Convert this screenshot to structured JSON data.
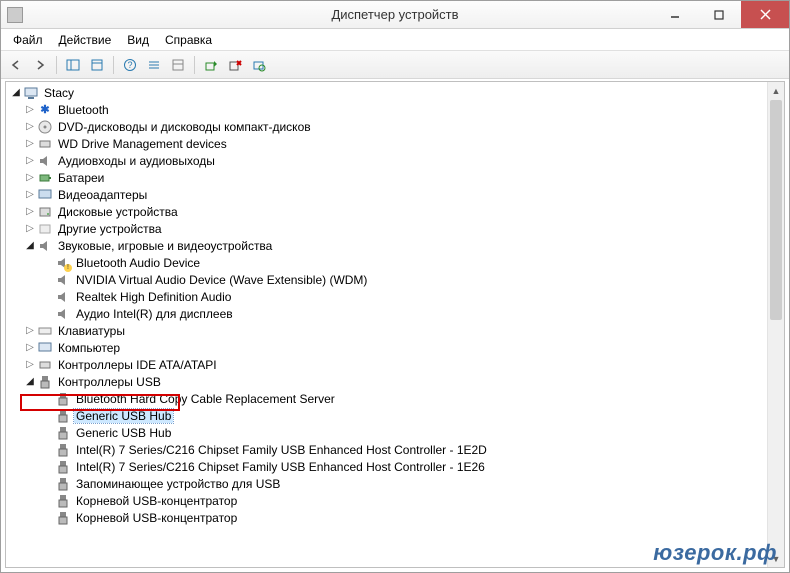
{
  "window": {
    "title": "Диспетчер устройств",
    "min_tooltip": "Свернуть",
    "max_tooltip": "Развернуть",
    "close_tooltip": "Закрыть"
  },
  "menu": {
    "file": "Файл",
    "action": "Действие",
    "view": "Вид",
    "help": "Справка"
  },
  "tree": {
    "root": "Stacy",
    "categories": [
      {
        "icon": "bluetooth",
        "label": "Bluetooth"
      },
      {
        "icon": "dvd",
        "label": "DVD-дисководы и дисководы компакт-дисков"
      },
      {
        "icon": "wd",
        "label": "WD Drive Management devices"
      },
      {
        "icon": "audio",
        "label": "Аудиовходы и аудиовыходы"
      },
      {
        "icon": "battery",
        "label": "Батареи"
      },
      {
        "icon": "video",
        "label": "Видеоадаптеры"
      },
      {
        "icon": "disk",
        "label": "Дисковые устройства"
      },
      {
        "icon": "other",
        "label": "Другие устройства"
      }
    ],
    "sound_category": {
      "label": "Звуковые, игровые и видеоустройства",
      "children": [
        {
          "label": "Bluetooth Audio Device",
          "warning": true
        },
        {
          "label": "NVIDIA Virtual Audio Device (Wave Extensible) (WDM)"
        },
        {
          "label": "Realtek High Definition Audio"
        },
        {
          "label": "Аудио Intel(R) для дисплеев"
        }
      ]
    },
    "more_categories": [
      {
        "icon": "keyboard",
        "label": "Клавиатуры"
      },
      {
        "icon": "computer",
        "label": "Компьютер"
      },
      {
        "icon": "ide",
        "label": "Контроллеры IDE ATA/ATAPI"
      }
    ],
    "usb_category": {
      "label": "Контроллеры USB",
      "children": [
        {
          "label": "Bluetooth Hard Copy Cable Replacement Server"
        },
        {
          "label": "Generic USB Hub",
          "selected": true
        },
        {
          "label": "Generic USB Hub"
        },
        {
          "label": "Intel(R) 7 Series/C216 Chipset Family USB Enhanced Host Controller - 1E2D"
        },
        {
          "label": "Intel(R) 7 Series/C216 Chipset Family USB Enhanced Host Controller - 1E26"
        },
        {
          "label": "Запоминающее устройство для USB"
        },
        {
          "label": "Корневой USB-концентратор"
        },
        {
          "label": "Корневой USB-концентратор"
        }
      ]
    }
  },
  "watermark": "юзерок.рф"
}
